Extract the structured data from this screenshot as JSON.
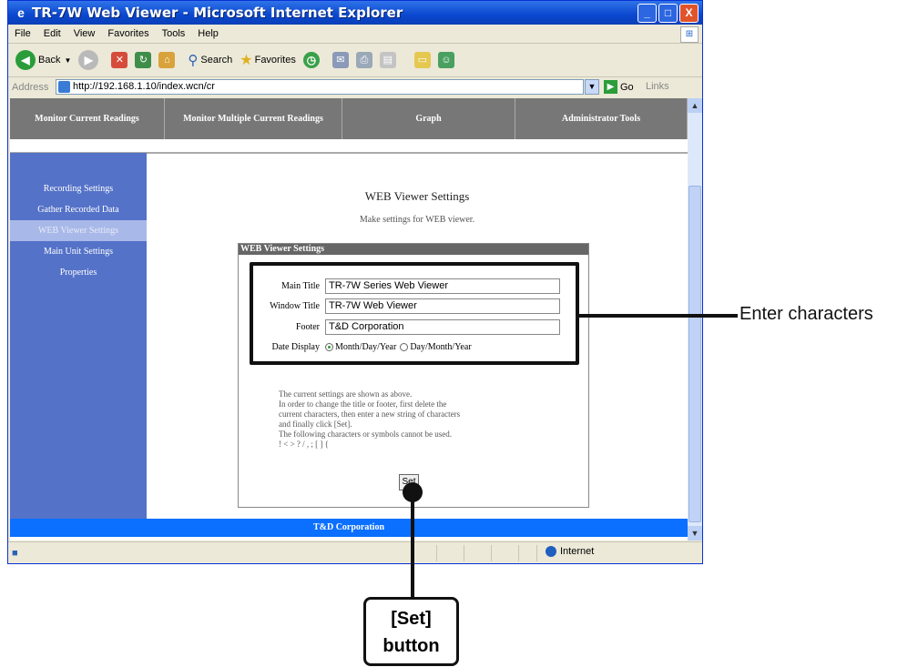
{
  "window": {
    "title": "TR-7W Web Viewer - Microsoft Internet Explorer",
    "min": "_",
    "max": "□",
    "close": "X"
  },
  "menu": [
    "File",
    "Edit",
    "View",
    "Favorites",
    "Tools",
    "Help"
  ],
  "toolbar": {
    "back": "Back",
    "search": "Search",
    "favorites": "Favorites"
  },
  "address": {
    "label": "Address",
    "url": "http://192.168.1.10/index.wcn/cr",
    "go": "Go",
    "links": "Links"
  },
  "nav": {
    "tabs": [
      "Monitor Current Readings",
      "Monitor Multiple Current Readings",
      "Graph",
      "Administrator Tools"
    ]
  },
  "sidebar": {
    "items": [
      "Recording Settings",
      "Gather Recorded Data",
      "WEB Viewer Settings",
      "Main Unit Settings",
      "Properties"
    ]
  },
  "main": {
    "title": "WEB Viewer Settings",
    "subtitle": "Make settings for WEB viewer.",
    "panel_title": "WEB Viewer Settings",
    "fields": {
      "main_title_label": "Main Title",
      "main_title_value": "TR-7W Series Web Viewer",
      "window_title_label": "Window Title",
      "window_title_value": "TR-7W Web Viewer",
      "footer_label": "Footer",
      "footer_value": "T&D Corporation",
      "date_label": "Date Display",
      "date_opt1": "Month/Day/Year",
      "date_opt2": "Day/Month/Year"
    },
    "notes": [
      "The current settings are shown as above.",
      "In order to change the title or footer, first delete the",
      "current characters, then enter a new string of characters",
      "and finally click [Set].",
      "The following characters or symbols cannot be used.",
      "! < > ? / , ; [ ] {"
    ],
    "set_button": "Set"
  },
  "footer": "T&D Corporation",
  "status": {
    "zone": "Internet"
  },
  "annotations": {
    "enter": "Enter characters",
    "set_line1": "[Set]",
    "set_line2": "button"
  }
}
